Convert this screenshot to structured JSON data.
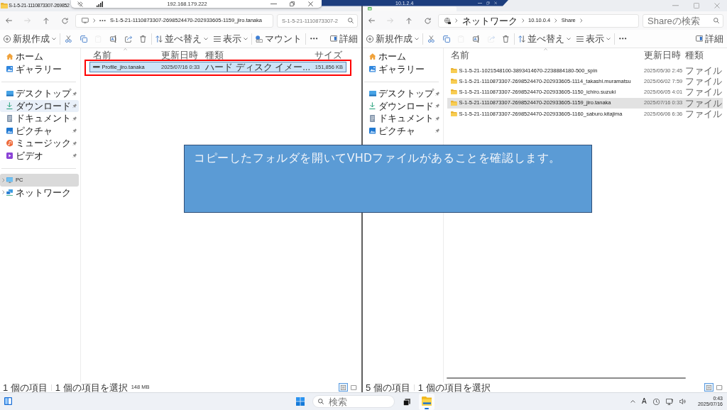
{
  "remote_bars": [
    {
      "kind": "light",
      "host": "192.168.179.222"
    },
    {
      "kind": "dark",
      "host": "10.1.2.4"
    }
  ],
  "windows": [
    {
      "active": true,
      "title_bar": {
        "kind": "caption",
        "title": "S-1-5-21-1110873307-269852",
        "window_controls": false
      },
      "nav_buttons": [
        {
          "kind": "back",
          "disabled": false
        },
        {
          "kind": "forward",
          "disabled": true
        },
        {
          "kind": "up",
          "disabled": false
        },
        {
          "kind": "refresh",
          "disabled": false
        }
      ],
      "address": {
        "kind": "computer",
        "overflow_button": true,
        "segments": [
          "S-1-5-21-1110873307-2698524470-202933605-1159_jiro.tanaka"
        ],
        "trailing_chevron": false
      },
      "search": {
        "placeholder": "S-1-5-21-1110873307-2"
      },
      "toolbar": {
        "groups": [
          [
            {
              "kind": "new",
              "label": "新規作成",
              "dropdown": true
            }
          ],
          [
            {
              "kind": "cut",
              "disabled": false
            },
            {
              "kind": "copy",
              "disabled": false
            },
            {
              "kind": "paste",
              "disabled": true
            },
            {
              "kind": "rename",
              "disabled": false
            },
            {
              "kind": "share",
              "disabled": false
            },
            {
              "kind": "delete",
              "disabled": false
            }
          ],
          [
            {
              "kind": "sort",
              "label": "並べ替え",
              "dropdown": true
            },
            {
              "kind": "view",
              "label": "表示",
              "dropdown": true
            }
          ],
          [
            {
              "kind": "mount",
              "label": "マウント",
              "dropdown": false
            }
          ],
          [
            {
              "kind": "more"
            }
          ]
        ],
        "end": [
          {
            "kind": "details",
            "label": "詳細"
          }
        ]
      },
      "sidebar": [
        [
          {
            "kind": "home",
            "label": "ホーム",
            "hovered": false,
            "selected": false
          },
          {
            "kind": "gallery",
            "label": "ギャラリー",
            "hovered": false,
            "selected": false
          }
        ],
        [
          {
            "kind": "desktop",
            "label": "デスクトップ",
            "pinned": true,
            "hovered": false,
            "selected": false
          },
          {
            "kind": "downloads",
            "label": "ダウンロード",
            "pinned": true,
            "hovered": true,
            "selected": false
          },
          {
            "kind": "documents",
            "label": "ドキュメント",
            "pinned": true,
            "hovered": false,
            "selected": false
          },
          {
            "kind": "pictures",
            "label": "ピクチャ",
            "pinned": true,
            "hovered": false,
            "selected": false
          },
          {
            "kind": "music",
            "label": "ミュージック",
            "pinned": true,
            "hovered": false,
            "selected": false
          },
          {
            "kind": "videos",
            "label": "ビデオ",
            "pinned": true,
            "hovered": false,
            "selected": false
          }
        ],
        [
          {
            "kind": "pc",
            "label": "PC",
            "expanded": false,
            "hovered": false,
            "selected": true
          },
          {
            "kind": "network",
            "label": "ネットワーク",
            "expanded": false,
            "hovered": false,
            "selected": false
          }
        ]
      ],
      "columns": [
        {
          "label": "名前",
          "sorted": true
        },
        {
          "label": "更新日時",
          "sorted": false
        },
        {
          "label": "種類",
          "sorted": false
        },
        {
          "label": "サイズ",
          "sorted": false
        }
      ],
      "rows": [
        {
          "kind": "disk_image",
          "name": "Profile_jiro.tanaka",
          "modified": "2025/07/16 0:33",
          "type": "ハード ディスク イメー...",
          "size": "151,856 KB",
          "selected": true,
          "outlined": true
        }
      ],
      "horizontal_scrollbar": false,
      "status_bar": {
        "item_count": "1 個の項目",
        "selection": "1 個の項目を選択",
        "selection_size": "148 MB",
        "view_modes": [
          {
            "kind": "details",
            "selected": true
          },
          {
            "kind": "tiles",
            "selected": false
          }
        ]
      }
    },
    {
      "active": false,
      "title_bar": {
        "kind": "tabbed",
        "window_controls": true
      },
      "nav_buttons": [
        {
          "kind": "back",
          "disabled": false
        },
        {
          "kind": "forward",
          "disabled": true
        },
        {
          "kind": "up",
          "disabled": false
        },
        {
          "kind": "refresh",
          "disabled": false
        }
      ],
      "address": {
        "kind": "network",
        "overflow_button": false,
        "segments": [
          "ネットワーク",
          "10.10.0.4",
          "Share"
        ],
        "trailing_chevron": true
      },
      "search": {
        "placeholder": "Shareの検索"
      },
      "toolbar": {
        "groups": [
          [
            {
              "kind": "new",
              "label": "新規作成",
              "dropdown": true
            }
          ],
          [
            {
              "kind": "cut",
              "disabled": false
            },
            {
              "kind": "copy",
              "disabled": false
            },
            {
              "kind": "paste",
              "disabled": true
            },
            {
              "kind": "rename",
              "disabled": false
            },
            {
              "kind": "share",
              "disabled": true
            },
            {
              "kind": "delete",
              "disabled": false
            }
          ],
          [
            {
              "kind": "sort",
              "label": "並べ替え",
              "dropdown": true
            },
            {
              "kind": "view",
              "label": "表示",
              "dropdown": true
            }
          ],
          [
            {
              "kind": "more"
            }
          ]
        ],
        "end": [
          {
            "kind": "details",
            "label": "詳細"
          }
        ]
      },
      "sidebar": [
        [
          {
            "kind": "home",
            "label": "ホーム",
            "hovered": false,
            "selected": false
          },
          {
            "kind": "gallery",
            "label": "ギャラリー",
            "hovered": false,
            "selected": false
          }
        ],
        [
          {
            "kind": "desktop",
            "label": "デスクトップ",
            "pinned": true,
            "hovered": false,
            "selected": false
          },
          {
            "kind": "downloads",
            "label": "ダウンロード",
            "pinned": true,
            "hovered": false,
            "selected": false
          },
          {
            "kind": "documents",
            "label": "ドキュメント",
            "pinned": true,
            "hovered": false,
            "selected": false
          },
          {
            "kind": "pictures",
            "label": "ピクチャ",
            "pinned": true,
            "hovered": false,
            "selected": false
          }
        ]
      ],
      "columns": [
        {
          "label": "名前",
          "sorted": true
        },
        {
          "label": "更新日時",
          "sorted": false
        },
        {
          "label": "種類",
          "sorted": false
        }
      ],
      "rows": [
        {
          "kind": "folder",
          "name": "S-1-5-21-1021548100-3893414670-2238884180-500_spin",
          "modified": "2025/05/30 2:45",
          "type": "ファイル",
          "selected": false,
          "outlined": false
        },
        {
          "kind": "folder",
          "name": "S-1-5-21-1110873307-2698524470-202933605-1114_takashi.muramatsu",
          "modified": "2025/06/02 7:59",
          "type": "ファイル",
          "selected": false,
          "outlined": false
        },
        {
          "kind": "folder",
          "name": "S-1-5-21-1110873307-2698524470-202933605-1150_ichiro.suzuki",
          "modified": "2025/06/05 4:01",
          "type": "ファイル",
          "selected": false,
          "outlined": false
        },
        {
          "kind": "folder",
          "name": "S-1-5-21-1110873307-2698524470-202933605-1159_jiro.tanaka",
          "modified": "2025/07/16 0:33",
          "type": "ファイル",
          "selected": true,
          "outlined": false
        },
        {
          "kind": "folder",
          "name": "S-1-5-21-1110873307-2698524470-202933605-1160_saburo.kitajima",
          "modified": "2025/06/06 6:36",
          "type": "ファイル",
          "selected": false,
          "outlined": false
        }
      ],
      "horizontal_scrollbar": true,
      "status_bar": {
        "item_count": "5 個の項目",
        "selection": "1 個の項目を選択",
        "view_modes": [
          {
            "kind": "details",
            "selected": true
          },
          {
            "kind": "tiles",
            "selected": false
          }
        ]
      }
    }
  ],
  "callout": {
    "text": "コピーしたフォルダを開いてVHDファイルがあることを確認します。"
  },
  "taskbar": {
    "search": {
      "placeholder": "検索"
    },
    "apps": [
      {
        "kind": "task_view",
        "active": false
      },
      {
        "kind": "explorer",
        "active": true
      }
    ],
    "ime_mode": "A",
    "clock": {
      "time": "0:43",
      "date": "2025/07/16"
    }
  }
}
